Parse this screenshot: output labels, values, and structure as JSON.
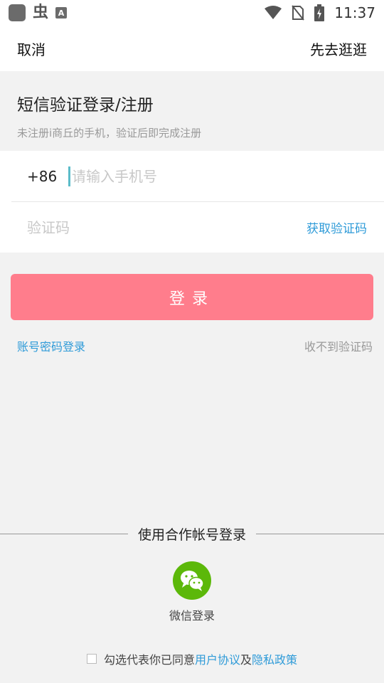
{
  "status_bar": {
    "app_icon_text": "A",
    "app2_glyph": "虫",
    "time": "11:37"
  },
  "topbar": {
    "cancel": "取消",
    "browse_first": "先去逛逛"
  },
  "intro": {
    "title": "短信验证登录/注册",
    "subtitle": "未注册i商丘的手机，验证后即完成注册"
  },
  "form": {
    "country_code": "+86",
    "phone_placeholder": "请输入手机号",
    "code_placeholder": "验证码",
    "get_code": "获取验证码"
  },
  "login_button": "登录",
  "links": {
    "password_login": "账号密码登录",
    "no_code": "收不到验证码"
  },
  "partner": {
    "label": "使用合作帐号登录",
    "wechat_label": "微信登录"
  },
  "agreement": {
    "prefix": "勾选代表你已同意",
    "user_agreement": "用户协议",
    "and": "及",
    "privacy": "隐私政策"
  },
  "colors": {
    "accent_blue": "#2f9bd8",
    "login_pink": "#ff7d8c",
    "wechat_green": "#5cb80a"
  }
}
